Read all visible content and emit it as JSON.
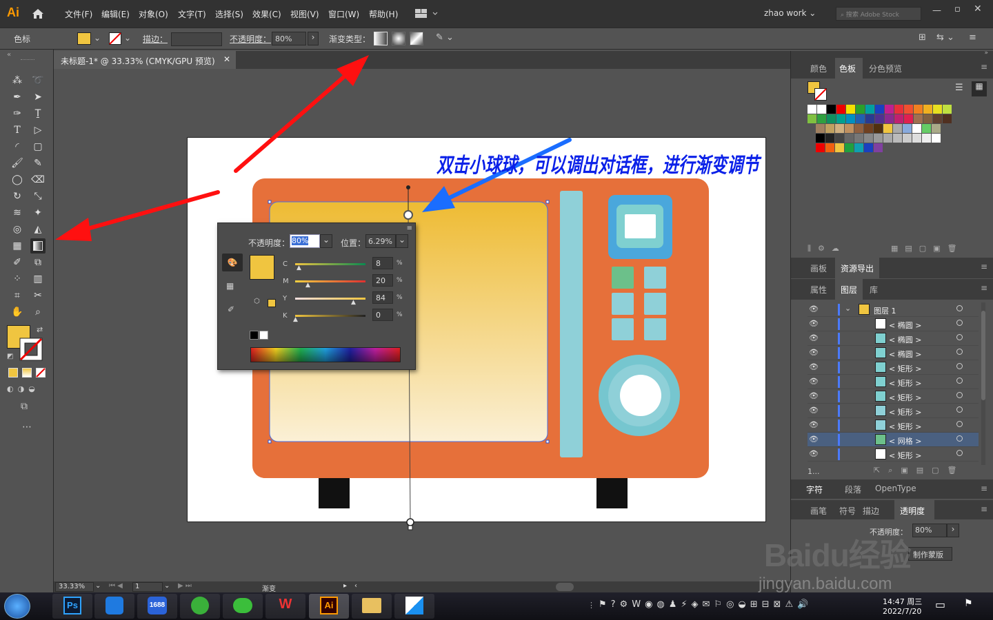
{
  "app": {
    "logo": "Ai"
  },
  "menu": [
    "文件(F)",
    "编辑(E)",
    "对象(O)",
    "文字(T)",
    "选择(S)",
    "效果(C)",
    "视图(V)",
    "窗口(W)",
    "帮助(H)"
  ],
  "workspace": "zhao work",
  "search_placeholder": "搜索 Adobe Stock",
  "control": {
    "swatch_label": "色标",
    "stroke_label": "描边：",
    "opacity_label": "不透明度：",
    "opacity_value": "80%",
    "gradient_type_label": "渐变类型："
  },
  "doc_tab": "未标题-1* @ 33.33% (CMYK/GPU 预览)",
  "annotation": "双击小球球，可以调出对话框，进行渐变调节",
  "gradient_popup": {
    "opacity_label": "不透明度：",
    "opacity_value": "80%",
    "position_label": "位置：",
    "position_value": "6.29%",
    "channels": [
      {
        "name": "C",
        "value": "8",
        "unit": "%"
      },
      {
        "name": "M",
        "value": "20",
        "unit": "%"
      },
      {
        "name": "Y",
        "value": "84",
        "unit": "%"
      },
      {
        "name": "K",
        "value": "0",
        "unit": "%"
      }
    ]
  },
  "status": {
    "zoom": "33.33%",
    "page": "1",
    "tool": "渐变"
  },
  "right_panel": {
    "tabs_top": [
      "颜色",
      "色板",
      "分色预览"
    ],
    "tabs_mid": [
      "画板",
      "资源导出"
    ],
    "tabs_layers": [
      "属性",
      "图层",
      "库"
    ],
    "layers": [
      {
        "name": "图层 1",
        "level": 0
      },
      {
        "name": "< 椭圆 >",
        "level": 1
      },
      {
        "name": "< 椭圆 >",
        "level": 1
      },
      {
        "name": "< 椭圆 >",
        "level": 1
      },
      {
        "name": "< 矩形 >",
        "level": 1
      },
      {
        "name": "< 矩形 >",
        "level": 1
      },
      {
        "name": "< 矩形 >",
        "level": 1
      },
      {
        "name": "< 矩形 >",
        "level": 1
      },
      {
        "name": "< 矩形 >",
        "level": 1
      },
      {
        "name": "< 网格 >",
        "level": 1
      },
      {
        "name": "< 矩形 >",
        "level": 1
      }
    ],
    "layer_count": "1...",
    "tabs_char": [
      "字符",
      "段落",
      "OpenType"
    ],
    "tabs_bottom": [
      "画笔",
      "符号",
      "描边",
      "透明度"
    ],
    "transparency_label": "不透明度：",
    "transparency_value": "80%",
    "make_mask": "制作蒙版"
  },
  "watermark": {
    "brand": "Baidu经验",
    "url": "jingyan.baidu.com"
  },
  "taskbar": {
    "time": "14:47 周三",
    "date": "2022/7/20"
  },
  "colors": {
    "microwave": "#e6703a",
    "panel_yellow": "#f0c540",
    "accent_blue": "#0a64ff"
  }
}
